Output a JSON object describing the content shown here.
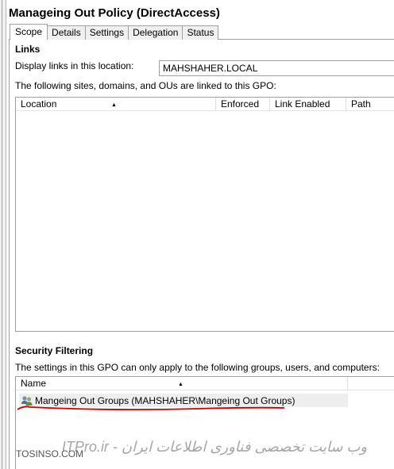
{
  "window": {
    "title": "Manageing Out Policy (DirectAccess)"
  },
  "tabs": [
    {
      "label": "Scope",
      "active": true
    },
    {
      "label": "Details",
      "active": false
    },
    {
      "label": "Settings",
      "active": false
    },
    {
      "label": "Delegation",
      "active": false
    },
    {
      "label": "Status",
      "active": false
    }
  ],
  "links": {
    "section_title": "Links",
    "display_label": "Display links in this location:",
    "display_value": "MAHSHAHER.LOCAL",
    "description": "The following sites, domains, and OUs are linked to this GPO:",
    "columns": [
      "Location",
      "Enforced",
      "Link Enabled",
      "Path"
    ]
  },
  "security_filtering": {
    "section_title": "Security Filtering",
    "description": "The settings in this GPO can only apply to the following groups, users, and computers:",
    "column": "Name",
    "items": [
      {
        "name": "Mangeing Out Groups (MAHSHAHER\\Mangeing Out Groups)",
        "icon": "group-icon"
      }
    ]
  },
  "watermark": {
    "text": "ITPro.ir - وب سایت تخصصی فناوری اطلاعات ایران",
    "site": "TOSINSO.COM"
  },
  "colors": {
    "highlight_underline": "#cc0000",
    "row_bg": "#eeeeee",
    "border": "#a0a0a0"
  }
}
